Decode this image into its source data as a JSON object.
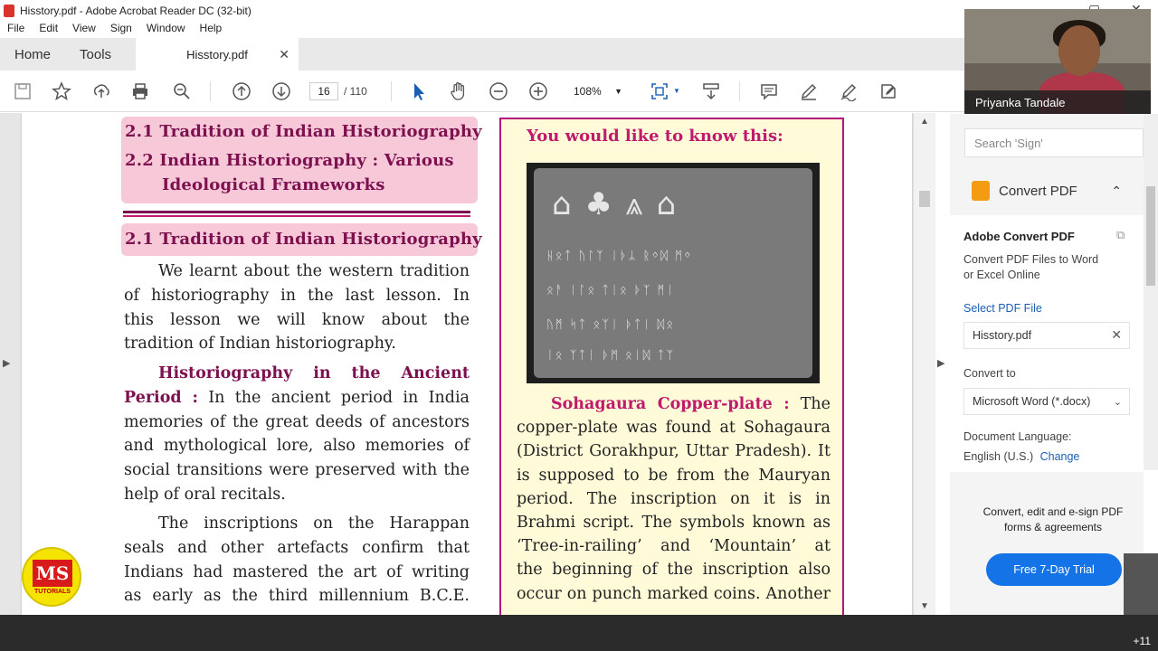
{
  "window": {
    "title": "Hisstory.pdf - Adobe Acrobat Reader DC (32-bit)"
  },
  "menu": [
    "File",
    "Edit",
    "View",
    "Sign",
    "Window",
    "Help"
  ],
  "tabs": {
    "home": "Home",
    "tools": "Tools",
    "document": "Hisstory.pdf"
  },
  "toolbar": {
    "page_current": "16",
    "page_total": "/ 110",
    "zoom": "108%"
  },
  "webcam": {
    "name": "Priyanka Tandale"
  },
  "document": {
    "heading_21": "2.1  Tradition of Indian Historiography",
    "heading_22_line1": "2.2  Indian Historiography : Various",
    "heading_22_line2": "Ideological Frameworks",
    "heading_21_repeat": "2.1  Tradition of Indian Historiography",
    "para1": [
      "We learnt about the western tradition",
      "of historiography in the last lesson. In",
      "this lesson we will know about the",
      "tradition of Indian historiography."
    ],
    "para2_bold_line1": "Historiography in the Ancient",
    "para2_bold_start": "Period :",
    "para2_line1_rest": "In the ancient period in India",
    "para2": [
      "memories of the great deeds of ancestors",
      "and mythological lore, also memories of",
      "social transitions were preserved with the",
      "help of oral recitals."
    ],
    "para3": [
      "The inscriptions on the Harappan",
      "seals and other artefacts confirm that",
      "Indians had mastered the art of writing",
      "as early as the third millennium B.C.E."
    ],
    "box_title": "You would like to know this:",
    "box_bold": "Sohagaura Copper-plate :",
    "box_line1_rest": "The",
    "box_lines": [
      "copper-plate was found at Sohagaura",
      "(District Gorakhpur, Uttar Pradesh). It",
      "is supposed to be from the Mauryan",
      "period. The inscription on it is in",
      "Brahmi script. The symbols known as",
      "‘Tree-in-railing’ and ‘Mountain’ at",
      "the beginning of the inscription also",
      "occur on punch marked coins. Another"
    ]
  },
  "logo": {
    "ms": "MS",
    "sub": "TUTORIALS"
  },
  "right_pane": {
    "search_placeholder": "Search 'Sign'",
    "convert_header": "Convert PDF",
    "card_title": "Adobe Convert PDF",
    "card_desc_1": "Convert PDF Files to Word",
    "card_desc_2": "or Excel Online",
    "select_label": "Select PDF File",
    "selected_file": "Hisstory.pdf",
    "convert_to_label": "Convert to",
    "convert_to_value": "Microsoft Word (*.docx)",
    "doc_lang_label": "Document Language:",
    "doc_lang_value": "English (U.S.)",
    "change_link": "Change",
    "promo_text": "Convert, edit and e-sign PDF forms & agreements",
    "trial_button": "Free 7-Day Trial"
  },
  "bottom": {
    "count": "+11"
  }
}
